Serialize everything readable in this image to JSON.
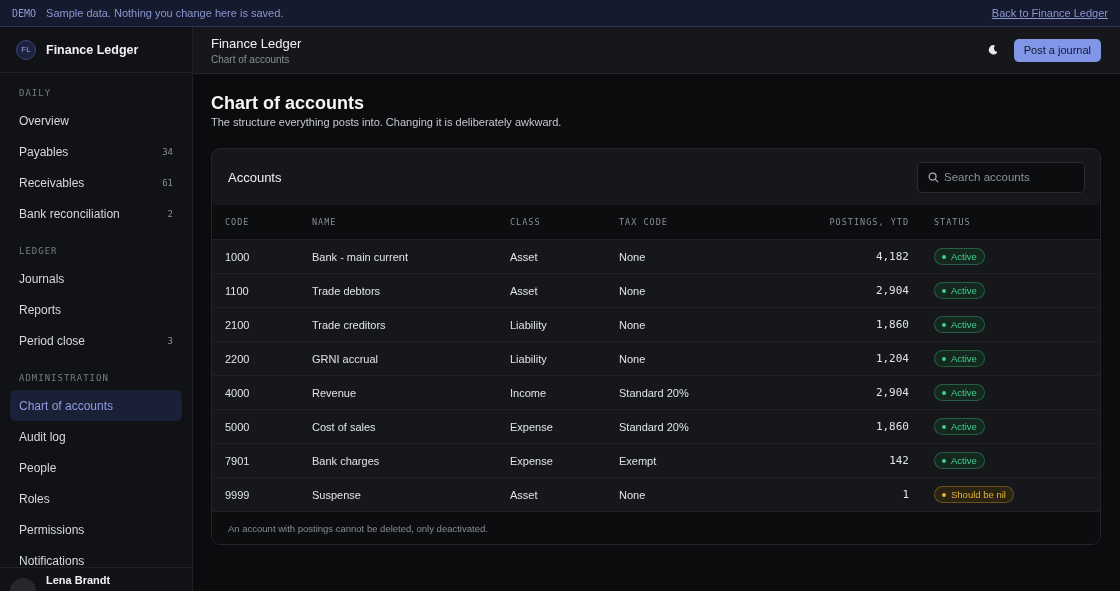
{
  "banner": {
    "tag": "DEMO",
    "message": "Sample data. Nothing you change here is saved.",
    "link": "Back to Finance Ledger"
  },
  "sidebar": {
    "logo": "FL",
    "app_name": "Finance Ledger",
    "sections": [
      {
        "label": "DAILY",
        "items": [
          {
            "label": "Overview",
            "selected": false
          },
          {
            "label": "Payables",
            "count": "34",
            "selected": false
          },
          {
            "label": "Receivables",
            "count": "61",
            "selected": false
          },
          {
            "label": "Bank reconciliation",
            "count": "2",
            "selected": false
          }
        ]
      },
      {
        "label": "LEDGER",
        "items": [
          {
            "label": "Journals",
            "selected": false
          },
          {
            "label": "Reports",
            "selected": false
          },
          {
            "label": "Period close",
            "count": "3",
            "selected": false
          }
        ]
      },
      {
        "label": "ADMINISTRATION",
        "items": [
          {
            "label": "Chart of accounts",
            "selected": true
          },
          {
            "label": "Audit log",
            "selected": false
          },
          {
            "label": "People",
            "selected": false
          },
          {
            "label": "Roles",
            "selected": false
          },
          {
            "label": "Permissions",
            "selected": false
          },
          {
            "label": "Notifications",
            "selected": false
          }
        ]
      }
    ],
    "user": {
      "name": "Lena Brandt"
    }
  },
  "header": {
    "title": "Finance Ledger",
    "subtitle": "Chart of accounts",
    "button": "Post a journal"
  },
  "page": {
    "title": "Chart of accounts",
    "description": "The structure everything posts into. Changing it is deliberately awkward."
  },
  "table": {
    "title": "Accounts",
    "search": {
      "placeholder": "Search accounts"
    },
    "columns": [
      "CODE",
      "NAME",
      "CLASS",
      "TAX CODE",
      "POSTINGS, YTD",
      "STATUS"
    ],
    "rows": [
      {
        "code": "1000",
        "name": "Bank - main current",
        "class": "Asset",
        "tax_code": "None",
        "postings": "4,182",
        "status": {
          "label": "Active",
          "kind": "ok"
        }
      },
      {
        "code": "1100",
        "name": "Trade debtors",
        "class": "Asset",
        "tax_code": "None",
        "postings": "2,904",
        "status": {
          "label": "Active",
          "kind": "ok"
        }
      },
      {
        "code": "2100",
        "name": "Trade creditors",
        "class": "Liability",
        "tax_code": "None",
        "postings": "1,860",
        "status": {
          "label": "Active",
          "kind": "ok"
        }
      },
      {
        "code": "2200",
        "name": "GRNI accrual",
        "class": "Liability",
        "tax_code": "None",
        "postings": "1,204",
        "status": {
          "label": "Active",
          "kind": "ok"
        }
      },
      {
        "code": "4000",
        "name": "Revenue",
        "class": "Income",
        "tax_code": "Standard 20%",
        "postings": "2,904",
        "status": {
          "label": "Active",
          "kind": "ok"
        }
      },
      {
        "code": "5000",
        "name": "Cost of sales",
        "class": "Expense",
        "tax_code": "Standard 20%",
        "postings": "1,860",
        "status": {
          "label": "Active",
          "kind": "ok"
        }
      },
      {
        "code": "7901",
        "name": "Bank charges",
        "class": "Expense",
        "tax_code": "Exempt",
        "postings": "142",
        "status": {
          "label": "Active",
          "kind": "ok"
        }
      },
      {
        "code": "9999",
        "name": "Suspense",
        "class": "Asset",
        "tax_code": "None",
        "postings": "1",
        "status": {
          "label": "Should be nil",
          "kind": "warning"
        }
      }
    ],
    "footnote": "An account with postings cannot be deleted, only deactivated."
  }
}
